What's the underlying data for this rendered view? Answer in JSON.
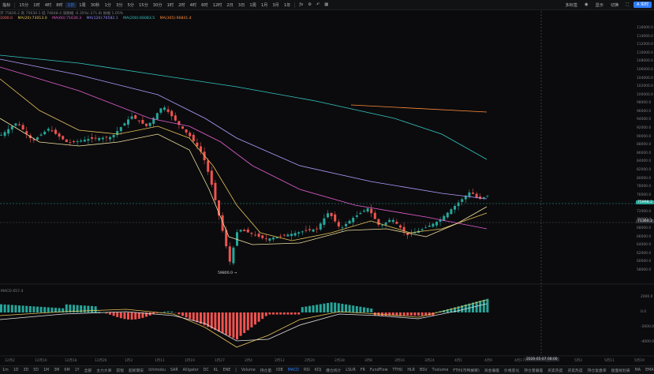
{
  "toolbar": {
    "symbol": "指标",
    "intervals": [
      "15分",
      "1时",
      "4时",
      "8时",
      "1日",
      "1周",
      "30秒",
      "1分",
      "3分",
      "5分",
      "15分",
      "30分",
      "1时",
      "2时",
      "4时",
      "6时",
      "12时",
      "2日",
      "3日",
      "1周",
      "1月",
      "3月",
      "1年"
    ],
    "active_interval_index": 4,
    "right_items": [
      "多标签",
      "显示",
      "切换"
    ],
    "live_label": "A 实时"
  },
  "info_line1": "开 75826.2  高 75630.1  低 74848.4  涨跌幅 -0.35%(-271.8)  振幅 1.05%",
  "ma_line": [
    {
      "label": "MA(20):73013.0",
      "color": "#e8c25a"
    },
    {
      "label": "MA(60):71630.3",
      "color": "#e35fd0"
    },
    {
      "label": "MA(120):76582.1",
      "color": "#8f8cff"
    },
    {
      "label": "MA(200):66083.5",
      "color": "#35c6c2"
    },
    {
      "label": "MA(365):96841.4",
      "color": "#ff8c3a"
    }
  ],
  "ma_first": {
    "label": "1000.0",
    "color": "#ff6b6b"
  },
  "y_axis_labels": [
    "116000.0",
    "114000.0",
    "112000.0",
    "110000.0",
    "108000.0",
    "106000.0",
    "104000.0",
    "102000.0",
    "100000.0",
    "98000.0",
    "96000.0",
    "94000.0",
    "92000.0",
    "90000.0",
    "88000.0",
    "86000.0",
    "84000.0",
    "82000.0",
    "80000.0",
    "78000.0",
    "76000.0",
    "74000.0",
    "72000.0",
    "70000.0",
    "68000.0",
    "66000.0",
    "64000.0",
    "62000.0",
    "60000.0",
    "58000.0"
  ],
  "current_price": "75998.2",
  "cross_price": "71360.2",
  "low_label": "59800.0 →",
  "macd_label": "MACD 657.4",
  "macd_axis": [
    "2000.0",
    "0.0",
    "-2000.0",
    "-4000.0"
  ],
  "x_dates": [
    "12月2",
    "12月10",
    "12月18",
    "12月26",
    "1月3",
    "1月11",
    "1月19",
    "1月27",
    "2月4",
    "2月12",
    "2月20",
    "2月28",
    "3月8",
    "3月16",
    "3月24",
    "4月1",
    "4月9",
    "4月17",
    "4月25",
    "5月3",
    "5月11",
    "5月19",
    "5月27"
  ],
  "cross_date": "2026-05-07 08:00",
  "bottom_items": [
    "1m",
    "1D",
    "3D",
    "5D",
    "1M",
    "3M",
    "6M",
    "1Y",
    "全部",
    "主力大单",
    "前程",
    "超新期安",
    "Ichimoku",
    "SAR",
    "Alligator",
    "DC",
    "KL",
    "ENE",
    "|",
    "Volume",
    "持仓量",
    "IOB",
    "MACD",
    "RSI",
    "KDJ",
    "爆仓统计",
    "LSUR",
    "FR",
    "FundFlow",
    "TTHU",
    "HLR",
    "BSV",
    "Tvolume",
    "FTHI(市鸭摘要)",
    "资金偏差",
    "价格变化",
    "持仓量偏差",
    "买卖热度",
    "买卖热度",
    "持仓复盘率",
    "盘面规划表",
    "MA",
    "EMA",
    "AVL",
    "TD",
    "主区隔离"
  ],
  "bottom_active_index": 22
}
